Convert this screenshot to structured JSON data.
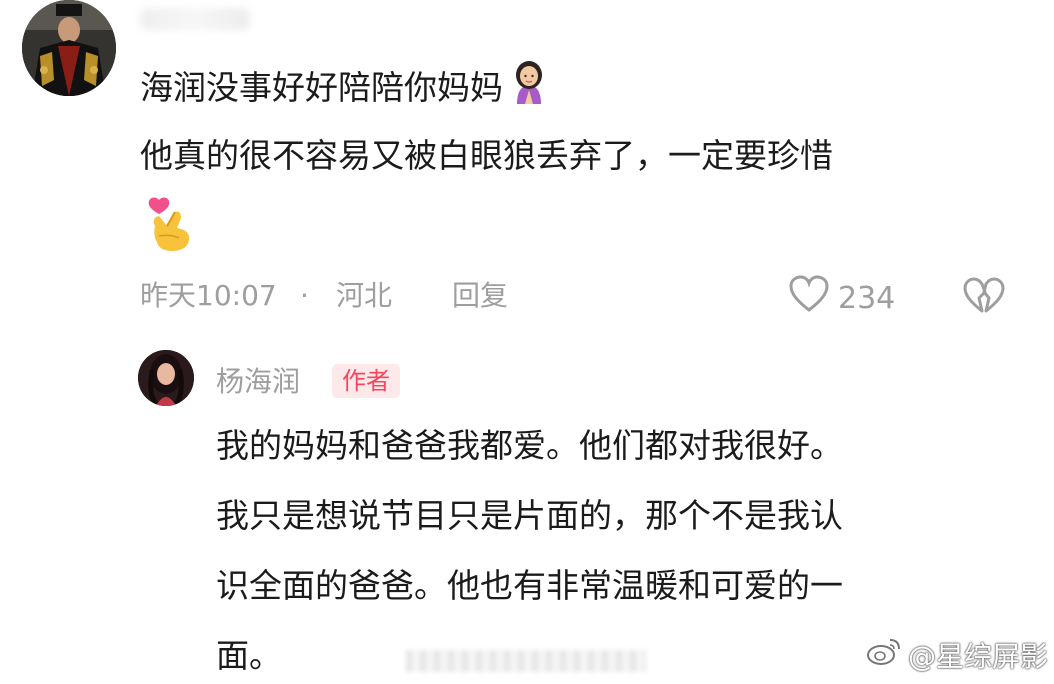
{
  "comment": {
    "line1": "海润没事好好陪陪你妈妈",
    "line2": "他真的很不容易又被白眼狼丢弃了，一定要珍惜",
    "emoji_line1": "woman-with-hands-clasped-emoji",
    "emoji_line3": "finger-heart-emoji",
    "time": "昨天10:07",
    "separator": "·",
    "location": "河北",
    "reply_label": "回复",
    "like_count": "234"
  },
  "reply": {
    "username": "杨海润",
    "badge": "作者",
    "lines": [
      "我的妈妈和爸爸我都爱。他们都对我很好。",
      "我只是想说节目只是片面的，那个不是我认",
      "识全面的爸爸。他也有非常温暖和可爱的一",
      "面。"
    ]
  },
  "watermark": {
    "prefix": "@",
    "text": "星综屏影"
  },
  "colors": {
    "text": "#1b1b1b",
    "meta": "#9e9e9e",
    "badge_bg": "#fde8ea",
    "badge_text": "#f2475e"
  }
}
